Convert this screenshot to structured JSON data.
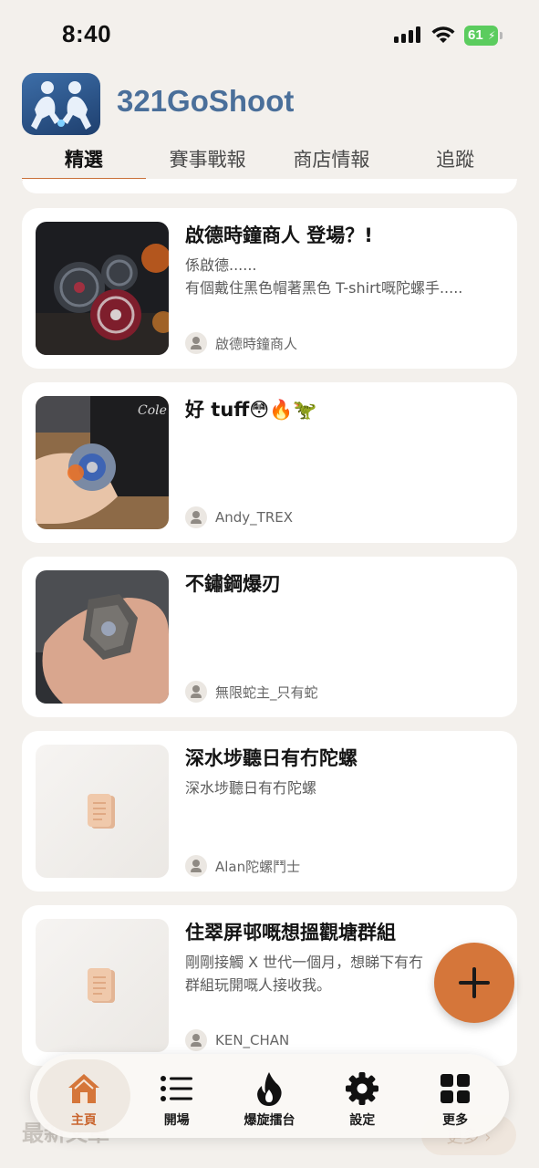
{
  "status_bar": {
    "time": "8:40",
    "battery": "61"
  },
  "app": {
    "title": "321GoShoot"
  },
  "tabs": [
    {
      "label": "精選",
      "active": true
    },
    {
      "label": "賽事戰報",
      "active": false
    },
    {
      "label": "商店情報",
      "active": false
    },
    {
      "label": "追蹤",
      "active": false
    }
  ],
  "posts": [
    {
      "title": "啟德時鐘商人 登場？!",
      "excerpt": "係啟德......\n有個戴住黑色帽著黑色 T-shirt嘅陀螺手.....",
      "author": "啟德時鐘商人",
      "thumbnail": "photo"
    },
    {
      "title": "好 tuff😳🔥🦖",
      "excerpt": "",
      "author": "Andy_TREX",
      "thumbnail": "photo"
    },
    {
      "title": "不鏽鋼爆刃",
      "excerpt": "",
      "author": "無限蛇主_只有蛇",
      "thumbnail": "photo"
    },
    {
      "title": "深水埗聽日有冇陀螺",
      "excerpt": "深水埗聽日有冇陀螺",
      "author": "Alan陀螺鬥士",
      "thumbnail": "document-icon"
    },
    {
      "title": "住翠屏邨嘅想搵觀塘群組",
      "excerpt": "剛剛接觸 X 世代一個月，想睇下有冇\n群組玩開嘅人接收我。",
      "author": "KEN_CHAN",
      "thumbnail": "document-icon"
    }
  ],
  "behind_nav": {
    "section_title": "最新文章",
    "button": "更多 ›"
  },
  "bottom_nav": [
    {
      "label": "主頁",
      "icon": "home-icon",
      "active": true
    },
    {
      "label": "開場",
      "icon": "list-icon",
      "active": false
    },
    {
      "label": "爆旋擂台",
      "icon": "flame-icon",
      "active": false
    },
    {
      "label": "設定",
      "icon": "gear-icon",
      "active": false
    },
    {
      "label": "更多",
      "icon": "grid-icon",
      "active": false
    }
  ],
  "colors": {
    "accent": "#d5763a",
    "title_blue": "#4a6f9a",
    "background": "#f3f0ec"
  }
}
